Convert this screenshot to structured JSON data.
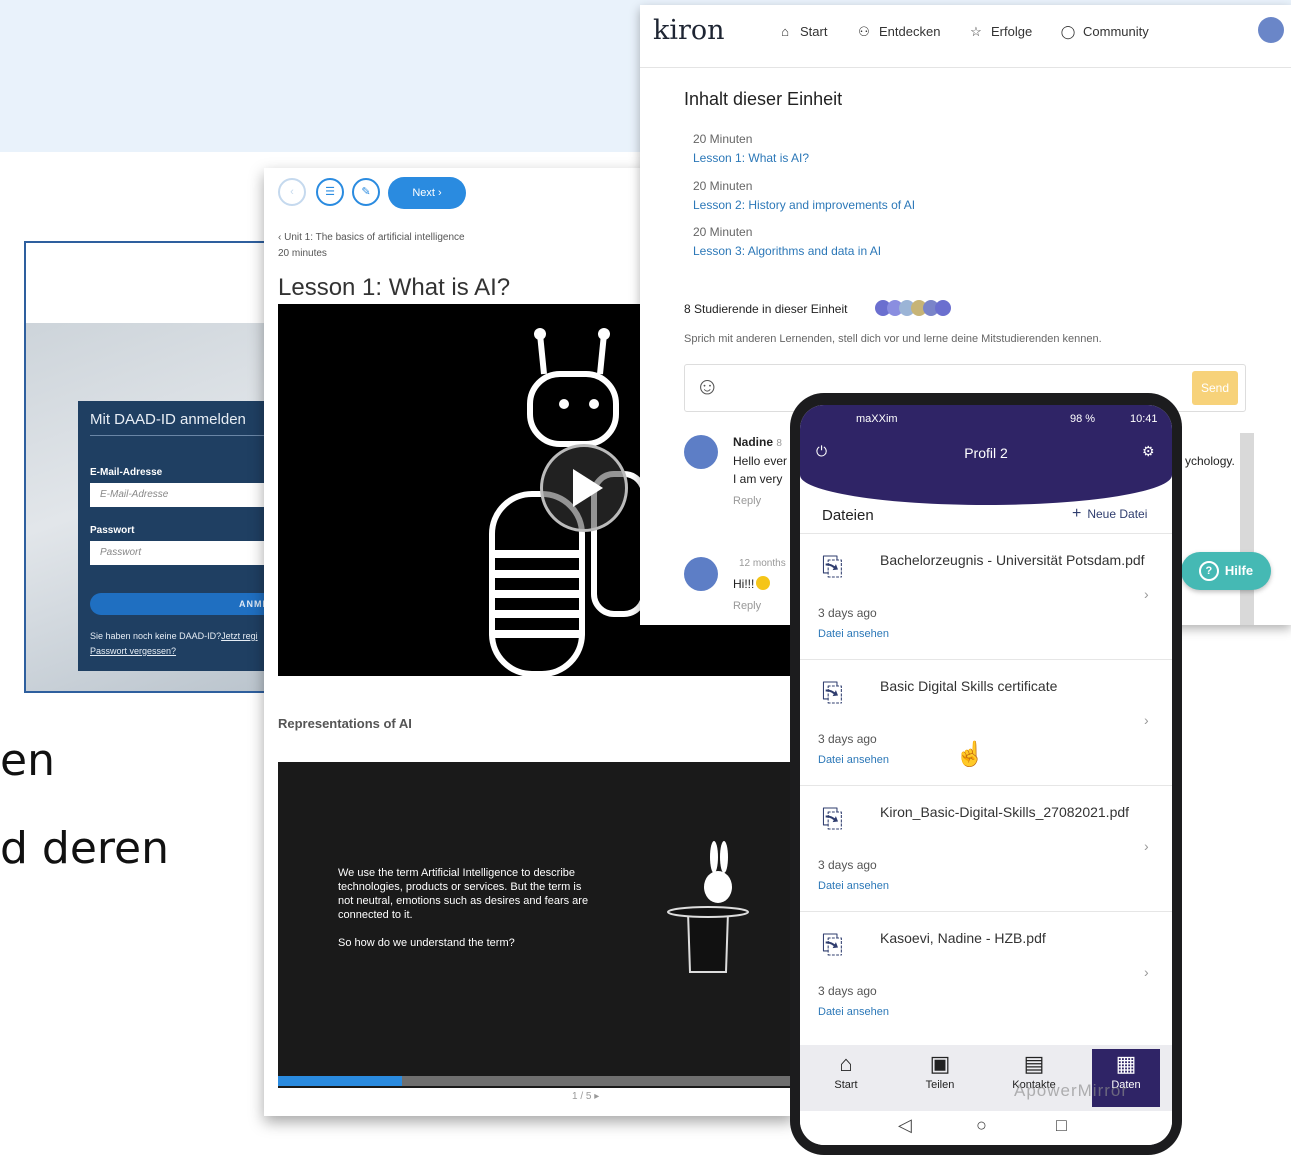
{
  "slide": {
    "partial_line1": "en",
    "partial_line2": "d deren"
  },
  "login": {
    "title": "Mit DAAD-ID anmelden",
    "email_label": "E-Mail-Adresse",
    "email_placeholder": "E-Mail-Adresse",
    "password_label": "Passwort",
    "password_placeholder": "Passwort",
    "login_button": "ANMEL",
    "no_account": "Sie haben noch keine DAAD-ID?",
    "register_link": "Jetzt regi",
    "forgot_link": "Passwort vergessen?"
  },
  "lesson": {
    "prev_icon": "‹",
    "menu_icon": "☰",
    "share_icon": "✎",
    "next_label": "Next ›",
    "breadcrumb": "‹ Unit 1: The basics of artificial intelligence",
    "minutes": "20 minutes",
    "title": "Lesson 1: What is AI?",
    "section": "Representations of AI",
    "slide_text": "We use the term Artificial Intelligence to describe technologies, products or services. But the term is not neutral, emotions such as desires and fears are connected to it.",
    "slide_question": "So how do we understand the term?",
    "page": "1 / 5  ▸",
    "progress": 0.24
  },
  "kiron": {
    "logo": "kiron",
    "nav": [
      {
        "label": "Start",
        "icon": "⌂"
      },
      {
        "label": "Entdecken",
        "icon": "⚇"
      },
      {
        "label": "Erfolge",
        "icon": "☆"
      },
      {
        "label": "Community",
        "icon": "◯"
      }
    ],
    "section_title": "Inhalt dieser Einheit",
    "lessons": [
      {
        "minutes": "20 Minuten",
        "title": "Lesson 1: What is AI?"
      },
      {
        "minutes": "20 Minuten",
        "title": "Lesson 2: History and improvements of AI"
      },
      {
        "minutes": "20 Minuten",
        "title": "Lesson 3: Algorithms and data in AI"
      }
    ],
    "students": "8 Studierende in dieser Einheit",
    "invite": "Sprich mit anderen Lernenden, stell dich vor und lerne deine Mitstudierenden kennen.",
    "send": "Send",
    "emoji": "☺",
    "comments": [
      {
        "name": "Nadine",
        "time": "8",
        "line1": "Hello ever",
        "line2": "I am very",
        "suffix": "ychology.",
        "reply": "Reply"
      },
      {
        "name": "",
        "time": "12 months",
        "line1": "Hi!!!",
        "line2": "",
        "suffix": "",
        "reply": "Reply"
      }
    ],
    "help": "Hilfe",
    "help_icon": "?"
  },
  "phone": {
    "carrier": "maXXim",
    "battery": "98 %",
    "time": "10:41",
    "title": "Profil 2",
    "section": "Dateien",
    "new_file": "Neue Datei",
    "files": [
      {
        "name": "Bachelorzeugnis - Universität Potsdam.pdf",
        "date": "3 days ago",
        "view": "Datei ansehen"
      },
      {
        "name": "Basic Digital Skills certificate",
        "date": "3 days ago",
        "view": "Datei ansehen"
      },
      {
        "name": "Kiron_Basic-Digital-Skills_27082021.pdf",
        "date": "3 days ago",
        "view": "Datei ansehen"
      },
      {
        "name": "Kasoevi, Nadine - HZB.pdf",
        "date": "3 days ago",
        "view": "Datei ansehen"
      }
    ],
    "tabs": [
      {
        "label": "Start",
        "icon": "⌂"
      },
      {
        "label": "Teilen",
        "icon": "▣"
      },
      {
        "label": "Kontakte",
        "icon": "▤"
      },
      {
        "label": "Daten",
        "icon": "▦"
      }
    ],
    "watermark": "ApowerMirror",
    "sys_back": "◁",
    "sys_home": "○",
    "sys_recent": "□"
  }
}
